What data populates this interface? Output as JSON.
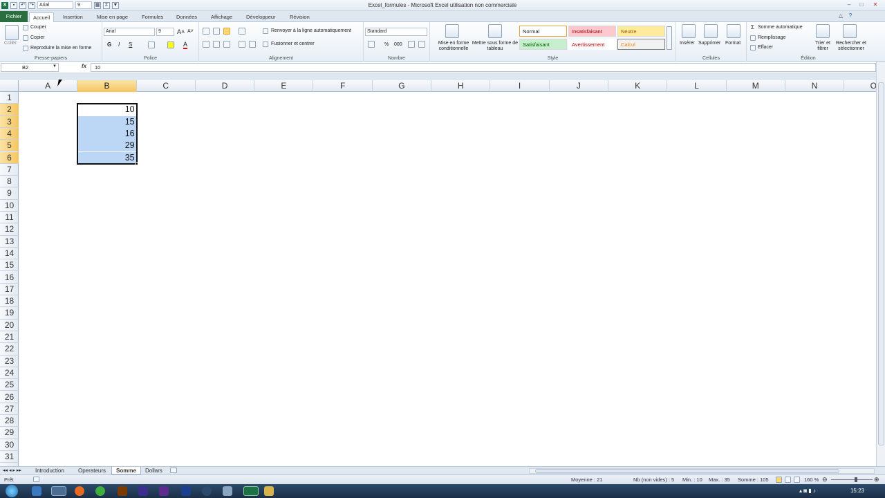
{
  "window": {
    "title": "Excel_formules - Microsoft Excel utilisation non commerciale"
  },
  "qat": {
    "font": "Arial",
    "size": "9"
  },
  "tabs": [
    "Fichier",
    "Accueil",
    "Insertion",
    "Mise en page",
    "Formules",
    "Données",
    "Affichage",
    "Développeur",
    "Révision"
  ],
  "ribbon": {
    "clipboard": {
      "paste": "Coller",
      "cut": "Couper",
      "copy": "Copier",
      "format_painter": "Reproduire la mise en forme",
      "label": "Presse-papiers"
    },
    "font": {
      "name": "Arial",
      "size": "9",
      "bold": "G",
      "italic": "I",
      "underline": "S",
      "label": "Police"
    },
    "alignment": {
      "wrap": "Renvoyer à la ligne automatiquement",
      "merge": "Fusionner et centrer",
      "label": "Alignement"
    },
    "number": {
      "format": "Standard",
      "percent": "%",
      "thousands": "000",
      "label": "Nombre"
    },
    "styles": {
      "conditional": "Mise en forme conditionnelle",
      "table": "Mettre sous forme de tableau",
      "normal": "Normal",
      "bad": "Insatisfaisant",
      "neutral": "Neutre",
      "good": "Satisfaisant",
      "warning": "Avertissement",
      "calc": "Calcul",
      "label": "Style"
    },
    "cells": {
      "insert": "Insérer",
      "delete": "Supprimer",
      "format": "Format",
      "label": "Cellules"
    },
    "editing": {
      "autosum": "Somme automatique",
      "fill": "Remplissage",
      "clear": "Effacer",
      "sort": "Trier et filtrer",
      "find": "Rechercher et sélectionner",
      "label": "Édition"
    }
  },
  "formula_bar": {
    "name_box": "B2",
    "fx": "fx",
    "value": "10"
  },
  "columns": [
    "A",
    "B",
    "C",
    "D",
    "E",
    "F",
    "G",
    "H",
    "I",
    "J",
    "K",
    "L",
    "M",
    "N",
    "O"
  ],
  "rows": [
    "1",
    "2",
    "3",
    "4",
    "5",
    "6",
    "7",
    "8",
    "9",
    "10",
    "11",
    "12",
    "13",
    "14",
    "15",
    "16",
    "17",
    "18",
    "19",
    "20",
    "21",
    "22",
    "23",
    "24",
    "25",
    "26",
    "27",
    "28",
    "29",
    "30",
    "31"
  ],
  "cells": {
    "B2": "10",
    "B3": "15",
    "B4": "16",
    "B5": "29",
    "B6": "35"
  },
  "sheets": [
    "Introduction",
    "Operateurs",
    "Somme",
    "Dollars"
  ],
  "active_sheet": "Somme",
  "status": {
    "ready": "Prêt",
    "average": "Moyenne : 21",
    "count": "Nb (non vides) : 5",
    "min": "Min. : 10",
    "max": "Max. : 35",
    "sum": "Somme : 105",
    "zoom": "160 %"
  },
  "taskbar": {
    "clock": "15:23"
  },
  "colors": {
    "file_tab": "#2a6e3f",
    "selection": "#bcd7f5",
    "header_selected": "#f4c660"
  }
}
